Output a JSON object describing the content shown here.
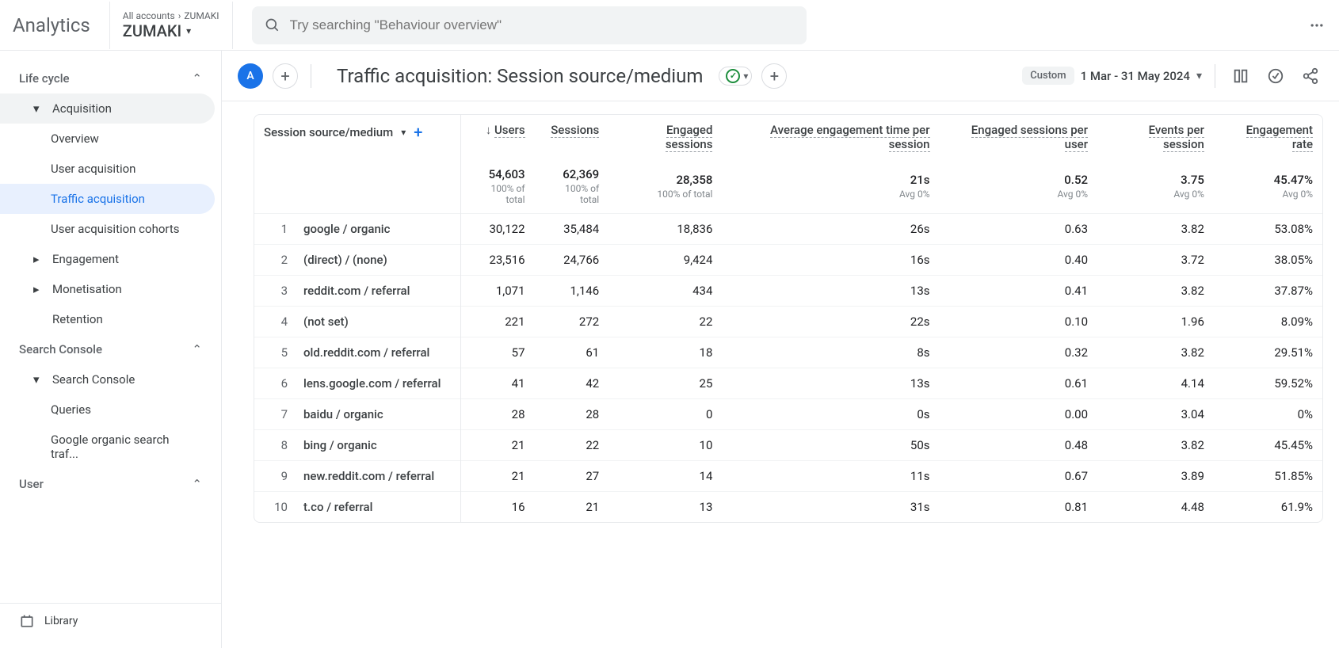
{
  "topbar": {
    "brand": "Analytics",
    "accounts_label": "All accounts",
    "property": "ZUMAKI",
    "property_dropdown": "ZUMAKI",
    "search_placeholder": "Try searching \"Behaviour overview\""
  },
  "sidebar": {
    "sections": {
      "lifecycle": "Life cycle",
      "searchconsole": "Search Console",
      "user": "User"
    },
    "items": {
      "acquisition": "Acquisition",
      "overview": "Overview",
      "user_acq": "User acquisition",
      "traffic_acq": "Traffic acquisition",
      "user_acq_cohorts": "User acquisition cohorts",
      "engagement": "Engagement",
      "monetisation": "Monetisation",
      "retention": "Retention",
      "search_console": "Search Console",
      "queries": "Queries",
      "google_org": "Google organic search traf...",
      "library": "Library"
    }
  },
  "report": {
    "avatar": "A",
    "title": "Traffic acquisition: Session source/medium",
    "custom_label": "Custom",
    "date_range": "1 Mar - 31 May 2024"
  },
  "table": {
    "dimension_header": "Session source/medium",
    "columns": [
      "Users",
      "Sessions",
      "Engaged sessions",
      "Average engagement time per session",
      "Engaged sessions per user",
      "Events per session",
      "Engagement rate"
    ],
    "totals": {
      "users": "54,603",
      "sessions": "62,369",
      "engaged": "28,358",
      "avg_time": "21s",
      "eng_per_user": "0.52",
      "events": "3.75",
      "eng_rate": "45.47%",
      "sub_pct": "100% of total",
      "sub_avg": "Avg 0%"
    },
    "rows": [
      {
        "n": "1",
        "dim": "google / organic",
        "users": "30,122",
        "sessions": "35,484",
        "engaged": "18,836",
        "time": "26s",
        "epu": "0.63",
        "eps": "3.82",
        "rate": "53.08%"
      },
      {
        "n": "2",
        "dim": "(direct) / (none)",
        "users": "23,516",
        "sessions": "24,766",
        "engaged": "9,424",
        "time": "16s",
        "epu": "0.40",
        "eps": "3.72",
        "rate": "38.05%"
      },
      {
        "n": "3",
        "dim": "reddit.com / referral",
        "users": "1,071",
        "sessions": "1,146",
        "engaged": "434",
        "time": "13s",
        "epu": "0.41",
        "eps": "3.82",
        "rate": "37.87%"
      },
      {
        "n": "4",
        "dim": "(not set)",
        "users": "221",
        "sessions": "272",
        "engaged": "22",
        "time": "22s",
        "epu": "0.10",
        "eps": "1.96",
        "rate": "8.09%"
      },
      {
        "n": "5",
        "dim": "old.reddit.com / referral",
        "users": "57",
        "sessions": "61",
        "engaged": "18",
        "time": "8s",
        "epu": "0.32",
        "eps": "3.82",
        "rate": "29.51%"
      },
      {
        "n": "6",
        "dim": "lens.google.com / referral",
        "users": "41",
        "sessions": "42",
        "engaged": "25",
        "time": "13s",
        "epu": "0.61",
        "eps": "4.14",
        "rate": "59.52%"
      },
      {
        "n": "7",
        "dim": "baidu / organic",
        "users": "28",
        "sessions": "28",
        "engaged": "0",
        "time": "0s",
        "epu": "0.00",
        "eps": "3.04",
        "rate": "0%"
      },
      {
        "n": "8",
        "dim": "bing / organic",
        "users": "21",
        "sessions": "22",
        "engaged": "10",
        "time": "50s",
        "epu": "0.48",
        "eps": "3.82",
        "rate": "45.45%"
      },
      {
        "n": "9",
        "dim": "new.reddit.com / referral",
        "users": "21",
        "sessions": "27",
        "engaged": "14",
        "time": "11s",
        "epu": "0.67",
        "eps": "3.89",
        "rate": "51.85%"
      },
      {
        "n": "10",
        "dim": "t.co / referral",
        "users": "16",
        "sessions": "21",
        "engaged": "13",
        "time": "31s",
        "epu": "0.81",
        "eps": "4.48",
        "rate": "61.9%"
      }
    ]
  }
}
